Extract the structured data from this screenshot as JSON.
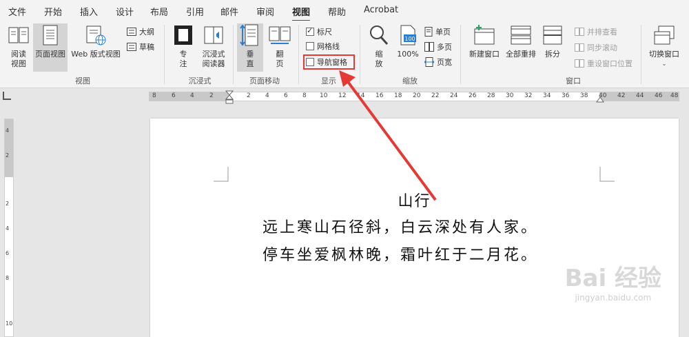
{
  "menu": {
    "tabs": [
      "文件",
      "开始",
      "插入",
      "设计",
      "布局",
      "引用",
      "邮件",
      "审阅",
      "视图",
      "帮助",
      "Acrobat"
    ],
    "active": "视图"
  },
  "ribbon": {
    "views_group": {
      "label": "视图",
      "read_mode": "阅读\n视图",
      "print_layout": "页面视图",
      "web_layout": "Web 版式视图",
      "outline": "大纲",
      "draft": "草稿"
    },
    "immersive_group": {
      "label": "沉浸式",
      "focus": "专\n注",
      "immersive_reader": "沉浸式\n阅读器"
    },
    "page_movement_group": {
      "label": "页面移动",
      "vertical": "垂\n直",
      "side_to_side": "翻\n页"
    },
    "show_group": {
      "label": "显示",
      "ruler": "标尺",
      "ruler_checked": true,
      "gridlines": "网格线",
      "gridlines_checked": false,
      "nav_pane": "导航窗格",
      "nav_pane_checked": false
    },
    "zoom_group": {
      "label": "缩放",
      "zoom": "缩\n放",
      "hundred": "100%",
      "hundred_icon_text": "100",
      "one_page": "单页",
      "multiple_pages": "多页",
      "page_width": "页宽"
    },
    "window_group": {
      "label": "窗口",
      "new_window": "新建窗口",
      "arrange_all": "全部重排",
      "split": "拆分",
      "side_by_side": "并排查看",
      "sync_scroll": "同步滚动",
      "reset_position": "重设窗口位置",
      "switch_windows": "切换窗口"
    }
  },
  "ruler": {
    "h_numbers": [
      "8",
      "6",
      "4",
      "2",
      "2",
      "4",
      "6",
      "8",
      "10",
      "12",
      "14",
      "16",
      "18",
      "20",
      "22",
      "24",
      "26",
      "28",
      "30",
      "32",
      "34",
      "36",
      "38",
      "40",
      "42",
      "44",
      "46",
      "48"
    ],
    "v_numbers": [
      "4",
      "2",
      "2",
      "4",
      "6",
      "8",
      "10"
    ]
  },
  "document": {
    "title": "山行",
    "lines": [
      "远上寒山石径斜，白云深处有人家。",
      "停车坐爱枫林晚，霜叶红于二月花。"
    ]
  },
  "watermark": {
    "main": "Bai 经验",
    "sub": "jingyan.baidu.com"
  },
  "colors": {
    "highlight": "#e53935",
    "arrow": "#e53935",
    "active_tab": "#2b579a"
  }
}
